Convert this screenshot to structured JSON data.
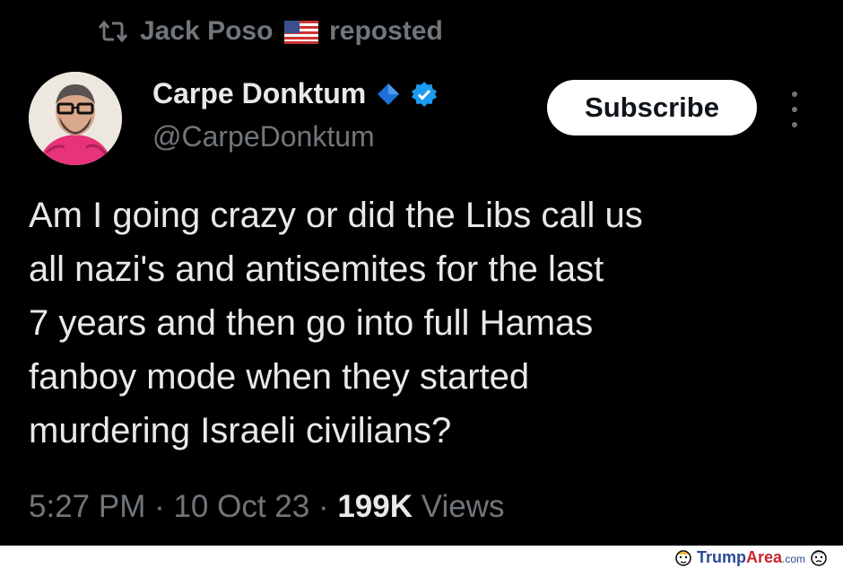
{
  "repost": {
    "user": "Jack Poso",
    "flag_icon": "us-flag-icon",
    "label": "reposted"
  },
  "author": {
    "name": "Carpe Donktum",
    "handle": "@CarpeDonktum",
    "badges": [
      "diamond-icon",
      "verified-icon"
    ]
  },
  "subscribe_label": "Subscribe",
  "tweet": {
    "lines": [
      "Am I going crazy or did the Libs call us",
      "all nazi's and antisemites for the last",
      "7 years and then go into full Hamas",
      "fanboy mode when they started",
      "murdering Israeli civilians?"
    ]
  },
  "meta": {
    "time": "5:27 PM",
    "sep1": " · ",
    "date": "10 Oct 23",
    "sep2": " · ",
    "views_count": "199K",
    "views_label": " Views"
  },
  "watermark": {
    "trump": "Trump",
    "area": "Area",
    "com": ".com"
  },
  "colors": {
    "background": "#000000",
    "text": "#e7e9ea",
    "muted": "#71767b",
    "verified": "#1d9bf0",
    "diamond": "#1d6fd9"
  }
}
